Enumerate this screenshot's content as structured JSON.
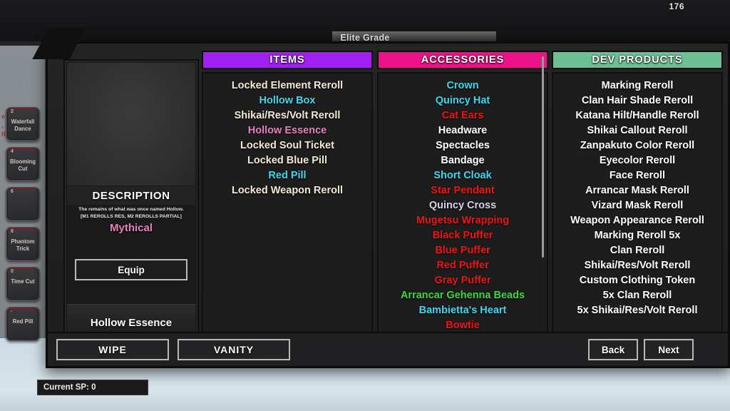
{
  "hud": {
    "top_counter": "176",
    "grade_label": "Elite Grade",
    "warning_text": "elow to\n, AFTER\nIP."
  },
  "ability_rail": {
    "slots": [
      {
        "key": "2",
        "label": "Waterfall Dance"
      },
      {
        "key": "4",
        "label": "Blooming Cut"
      },
      {
        "key": "6",
        "label": ""
      },
      {
        "key": "8",
        "label": "Phantom Trick"
      },
      {
        "key": "0",
        "label": "Time Cut"
      },
      {
        "key": "-",
        "label": "Red Pill"
      }
    ]
  },
  "detail": {
    "description_header": "DESCRIPTION",
    "description_text": "The remains of what was once named Hollow.",
    "description_subtext": "[M1 REROLLS RES, M2 REROLLS PARTIAL]",
    "rarity": "Mythical",
    "rarity_color": "#e87fc0",
    "equip_label": "Equip",
    "item_name": "Hollow Essence"
  },
  "columns": [
    {
      "title": "ITEMS",
      "header_color": "#a020f0",
      "entries": [
        {
          "label": "Locked Element Reroll",
          "color": "#f2ead6"
        },
        {
          "label": "Hollow Box",
          "color": "#3fd8ee"
        },
        {
          "label": "Shikai/Res/Volt Reroll",
          "color": "#f2ead6"
        },
        {
          "label": "Hollow Essence",
          "color": "#e87fc0"
        },
        {
          "label": "Locked Soul Ticket",
          "color": "#f2ead6"
        },
        {
          "label": "Locked Blue Pill",
          "color": "#f2ead6"
        },
        {
          "label": "Red Pill",
          "color": "#3fd8ee"
        },
        {
          "label": "Locked Weapon Reroll",
          "color": "#f2ead6"
        }
      ],
      "has_scrollbar": false
    },
    {
      "title": "ACCESSORIES",
      "header_color": "#ee1289",
      "entries": [
        {
          "label": "Crown",
          "color": "#3fd8ee"
        },
        {
          "label": "Quincy Hat",
          "color": "#3fd8ee"
        },
        {
          "label": "Cat Ears",
          "color": "#f01414"
        },
        {
          "label": "Headware",
          "color": "#ffffff"
        },
        {
          "label": "Spectacles",
          "color": "#ffffff"
        },
        {
          "label": "Bandage",
          "color": "#ffffff"
        },
        {
          "label": "Short Cloak",
          "color": "#3fd8ee"
        },
        {
          "label": "Star Pendant",
          "color": "#f01414"
        },
        {
          "label": "Quincy Cross",
          "color": "#d8d0ee"
        },
        {
          "label": "Mugetsu Wrapping",
          "color": "#f01414"
        },
        {
          "label": "Black Puffer",
          "color": "#f01414"
        },
        {
          "label": "Blue Puffer",
          "color": "#f01414"
        },
        {
          "label": "Red Puffer",
          "color": "#f01414"
        },
        {
          "label": "Gray Puffer",
          "color": "#f01414"
        },
        {
          "label": "Arrancar Gehenna Beads",
          "color": "#3fd83f"
        },
        {
          "label": "Bambietta's Heart",
          "color": "#3fd8ee"
        },
        {
          "label": "Bowtie",
          "color": "#f01414"
        }
      ],
      "has_scrollbar": true
    },
    {
      "title": "DEV PRODUCTS",
      "header_color": "#6dbf94",
      "entries": [
        {
          "label": "Marking Reroll",
          "color": "#ffffff"
        },
        {
          "label": "Clan Hair Shade Reroll",
          "color": "#ffffff"
        },
        {
          "label": "Katana Hilt/Handle Reroll",
          "color": "#ffffff"
        },
        {
          "label": "Shikai Callout Reroll",
          "color": "#ffffff"
        },
        {
          "label": "Zanpakuto Color Reroll",
          "color": "#ffffff"
        },
        {
          "label": "Eyecolor Reroll",
          "color": "#ffffff"
        },
        {
          "label": "Face Reroll",
          "color": "#ffffff"
        },
        {
          "label": "Arrancar Mask Reroll",
          "color": "#ffffff"
        },
        {
          "label": "Vizard Mask Reroll",
          "color": "#ffffff"
        },
        {
          "label": "Weapon Appearance Reroll",
          "color": "#ffffff"
        },
        {
          "label": "Marking Reroll 5x",
          "color": "#ffffff"
        },
        {
          "label": "Clan Reroll",
          "color": "#ffffff"
        },
        {
          "label": "Shikai/Res/Volt Reroll",
          "color": "#ffffff"
        },
        {
          "label": "Custom Clothing Token",
          "color": "#ffffff"
        },
        {
          "label": "5x Clan Reroll",
          "color": "#ffffff"
        },
        {
          "label": "5x Shikai/Res/Volt Reroll",
          "color": "#ffffff"
        }
      ],
      "has_scrollbar": false
    }
  ],
  "footer": {
    "wipe_label": "WIPE",
    "vanity_label": "VANITY",
    "back_label": "Back",
    "next_label": "Next"
  },
  "status": {
    "sp_label": "Current SP: 0"
  }
}
